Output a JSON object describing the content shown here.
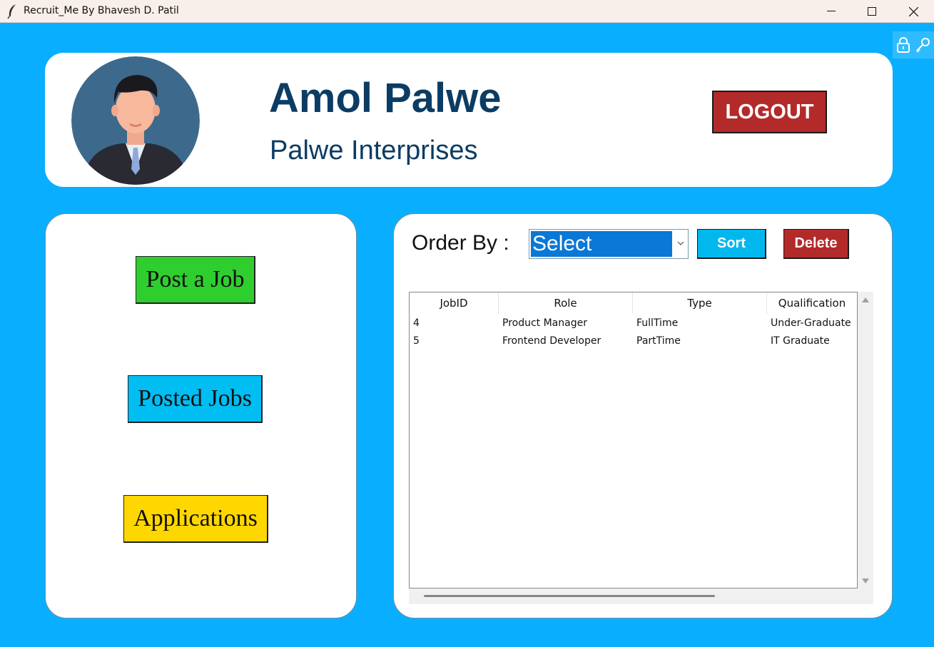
{
  "window": {
    "title": "Recruit_Me By Bhavesh D. Patil"
  },
  "header": {
    "user_name": "Amol Palwe",
    "company": "Palwe Interprises",
    "logout_label": "LOGOUT"
  },
  "sidebar": {
    "buttons": [
      {
        "label": "Post a Job",
        "color": "#2fce2f"
      },
      {
        "label": "Posted Jobs",
        "color": "#00bdf2"
      },
      {
        "label": "Applications",
        "color": "#ffd700"
      }
    ]
  },
  "toolbar": {
    "order_by_label": "Order By :",
    "select_value": "Select",
    "sort_label": "Sort",
    "delete_label": "Delete"
  },
  "table": {
    "columns": [
      "JobID",
      "Role",
      "Type",
      "Qualification"
    ],
    "rows": [
      [
        "4",
        "Product Manager",
        "FullTime",
        "Under-Graduate"
      ],
      [
        "5",
        "Frontend Developer",
        "PartTime",
        "IT Graduate"
      ]
    ]
  },
  "colors": {
    "background": "#0aaeff",
    "logout": "#b32a2a",
    "title_text": "#0b3c64",
    "select_highlight": "#0a78d6"
  }
}
